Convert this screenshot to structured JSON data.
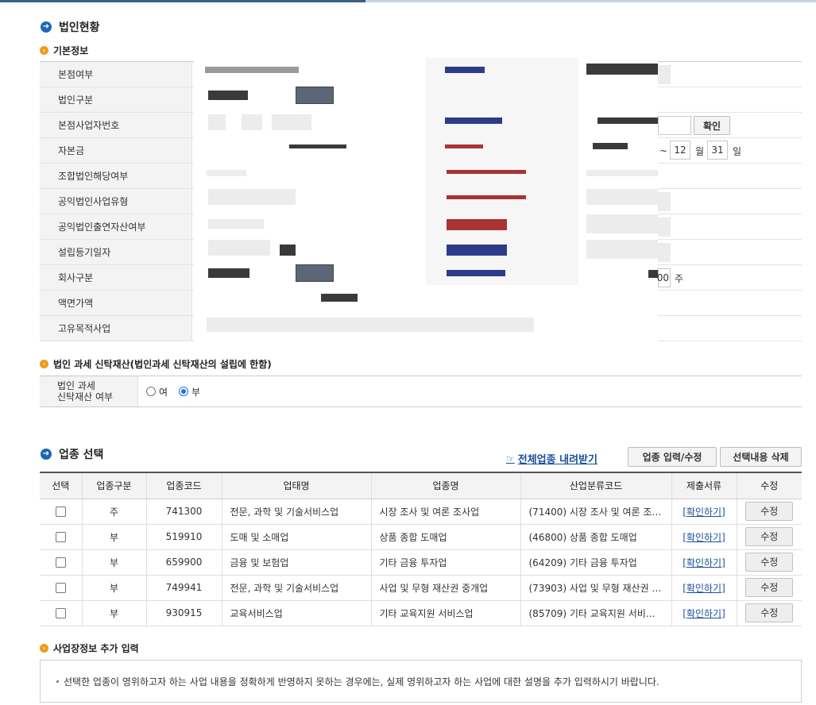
{
  "sections": {
    "corp_status": "법인현황",
    "basic_info": "기본정보",
    "trust": "법인 과세 신탁재산(법인과세 신탁재산의 설립에 한함)",
    "industry": "업종 선택",
    "extra": "사업장정보 추가 입력"
  },
  "basic_form": {
    "labels": [
      "본점여부",
      "법인구분",
      "본점사업자번호",
      "자본금",
      "조합법인해당여부",
      "공익법인사업유형",
      "공익법인출연자산여부",
      "설립등기일자",
      "회사구분",
      "액면가액",
      "고유목적사업"
    ],
    "confirm_button": "확인",
    "period": {
      "tilde": "~",
      "month": "12",
      "month_unit": "월",
      "day": "31",
      "day_unit": "일"
    },
    "shares": {
      "value": "00",
      "unit": "주"
    }
  },
  "trust": {
    "label": "법인 과세\n신탁재산 여부",
    "options": [
      {
        "label": "여",
        "selected": false
      },
      {
        "label": "부",
        "selected": true
      }
    ]
  },
  "industry": {
    "download_link": "전체업종 내려받기",
    "input_button": "업종 입력/수정",
    "delete_button": "선택내용 삭제",
    "columns": [
      "선택",
      "업종구분",
      "업종코드",
      "업태명",
      "업종명",
      "산업분류코드",
      "제출서류",
      "수정"
    ],
    "rows": [
      {
        "type": "주",
        "code": "741300",
        "business": "전문, 과학 및 기술서비스업",
        "item": "시장 조사 및 여론 조사업",
        "class_code": "(71400) 시장 조사 및 여론 조…",
        "doc": "[확인하기]",
        "edit": "수정"
      },
      {
        "type": "부",
        "code": "519910",
        "business": "도매 및 소매업",
        "item": "상품 종합 도매업",
        "class_code": "(46800) 상품 종합 도매업",
        "doc": "[확인하기]",
        "edit": "수정"
      },
      {
        "type": "부",
        "code": "659900",
        "business": "금융 및 보험업",
        "item": "기타 금융 투자업",
        "class_code": "(64209) 기타 금융 투자업",
        "doc": "[확인하기]",
        "edit": "수정"
      },
      {
        "type": "부",
        "code": "749941",
        "business": "전문, 과학 및 기술서비스업",
        "item": "사업 및 무형 재산권 중개업",
        "class_code": "(73903) 사업 및 무형 재산권 …",
        "doc": "[확인하기]",
        "edit": "수정"
      },
      {
        "type": "부",
        "code": "930915",
        "business": "교육서비스업",
        "item": "기타 교육지원 서비스업",
        "class_code": "(85709) 기타 교육지원 서비…",
        "doc": "[확인하기]",
        "edit": "수정"
      }
    ]
  },
  "note": "선택한 업종이 영위하고자 하는 사업 내용을 정확하게 반영하지 못하는 경우에는, 실제 영위하고자 하는 사업에 대한 설명을 추가 입력하시기 바랍니다."
}
